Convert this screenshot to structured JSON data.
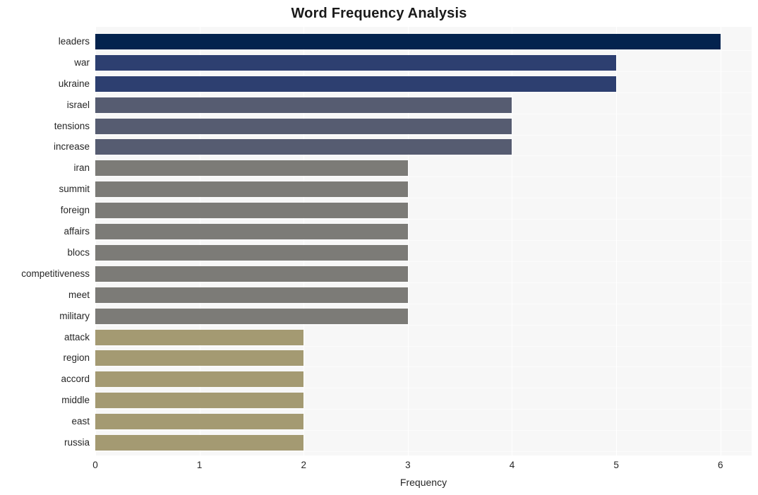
{
  "chart_data": {
    "type": "bar",
    "orientation": "horizontal",
    "title": "Word Frequency Analysis",
    "xlabel": "Frequency",
    "ylabel": "",
    "xlim": [
      0,
      6.3
    ],
    "xticks": [
      "0",
      "1",
      "2",
      "3",
      "4",
      "5",
      "6"
    ],
    "xtick_values": [
      0,
      1,
      2,
      3,
      4,
      5,
      6
    ],
    "grid": "vertical-major-white-on-light-panel",
    "legend": "none",
    "categories": [
      "leaders",
      "war",
      "ukraine",
      "israel",
      "tensions",
      "increase",
      "iran",
      "summit",
      "foreign",
      "affairs",
      "blocs",
      "competitiveness",
      "meet",
      "military",
      "attack",
      "region",
      "accord",
      "middle",
      "east",
      "russia"
    ],
    "values": [
      6,
      5,
      5,
      4,
      4,
      4,
      3,
      3,
      3,
      3,
      3,
      3,
      3,
      3,
      2,
      2,
      2,
      2,
      2,
      2
    ],
    "bar_colors": [
      "#04234e",
      "#2d3f70",
      "#2d3f70",
      "#565c71",
      "#565c71",
      "#565c71",
      "#7c7b77",
      "#7c7b77",
      "#7c7b77",
      "#7c7b77",
      "#7c7b77",
      "#7c7b77",
      "#7c7b77",
      "#7c7b77",
      "#a49a72",
      "#a49a72",
      "#a49a72",
      "#a49a72",
      "#a49a72",
      "#a49a72"
    ],
    "panel_background": "#f7f7f7",
    "gridline_color": "#ffffff",
    "title_color": "#1a1a1a",
    "tick_label_color": "#262626"
  }
}
